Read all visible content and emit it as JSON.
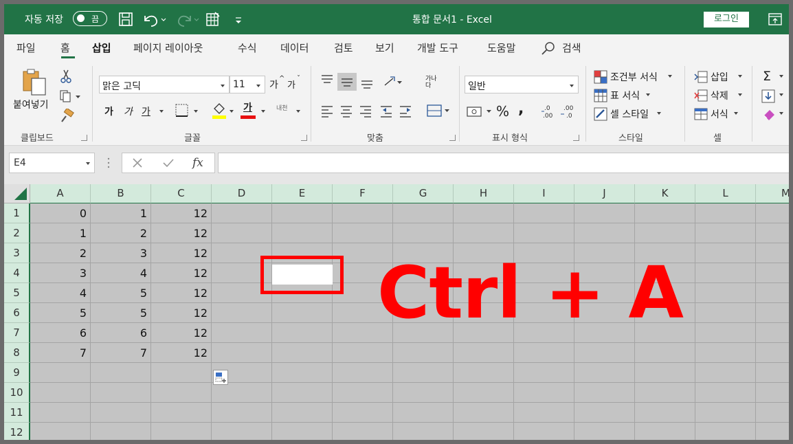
{
  "titlebar": {
    "autosave_label": "자동 저장",
    "autosave_state": "끔",
    "doc_title": "통합 문서1  -  Excel",
    "login_label": "로그인"
  },
  "tabs": [
    {
      "label": "파일"
    },
    {
      "label": "홈"
    },
    {
      "label": "삽입"
    },
    {
      "label": "페이지 레이아웃"
    },
    {
      "label": "수식"
    },
    {
      "label": "데이터"
    },
    {
      "label": "검토"
    },
    {
      "label": "보기"
    },
    {
      "label": "개발 도구"
    },
    {
      "label": "도움말"
    }
  ],
  "active_tab": "삽입",
  "search_label": "검색",
  "ribbon": {
    "clipboard": {
      "paste_label": "붙여넣기",
      "group_label": "클립보드"
    },
    "font": {
      "font_name": "맑은 고딕",
      "font_size": "11",
      "bold": "가",
      "italic": "가",
      "underline": "가",
      "phonetic": "내천",
      "group_label": "글꼴",
      "grow": "가",
      "shrink": "가",
      "font_color_letter": "가"
    },
    "alignment": {
      "group_label": "맞춤",
      "wrap_label": "가나다"
    },
    "number": {
      "format": "일반",
      "group_label": "표시 형식"
    },
    "styles": {
      "conditional": "조건부 서식",
      "table": "표 서식",
      "cell": "셀 스타일",
      "group_label": "스타일"
    },
    "cells": {
      "insert": "삽입",
      "delete": "삭제",
      "format": "서식",
      "group_label": "셀"
    }
  },
  "formula_bar": {
    "name_box": "E4",
    "formula": ""
  },
  "columns": [
    "A",
    "B",
    "C",
    "D",
    "E",
    "F",
    "G",
    "H",
    "I",
    "J",
    "K",
    "L",
    "M"
  ],
  "rows": [
    "1",
    "2",
    "3",
    "4",
    "5",
    "6",
    "7",
    "8",
    "9",
    "10",
    "11",
    "12"
  ],
  "cells": {
    "A": [
      "0",
      "1",
      "2",
      "3",
      "4",
      "5",
      "6",
      "7"
    ],
    "B": [
      "1",
      "2",
      "3",
      "4",
      "5",
      "5",
      "6",
      "7"
    ],
    "C": [
      "12",
      "12",
      "12",
      "12",
      "12",
      "12",
      "12",
      "12"
    ]
  },
  "overlay_text": "Ctrl + A",
  "colors": {
    "excel_green": "#217346",
    "highlight_red": "#ff0000",
    "selection_gray": "#c4c4c4"
  }
}
